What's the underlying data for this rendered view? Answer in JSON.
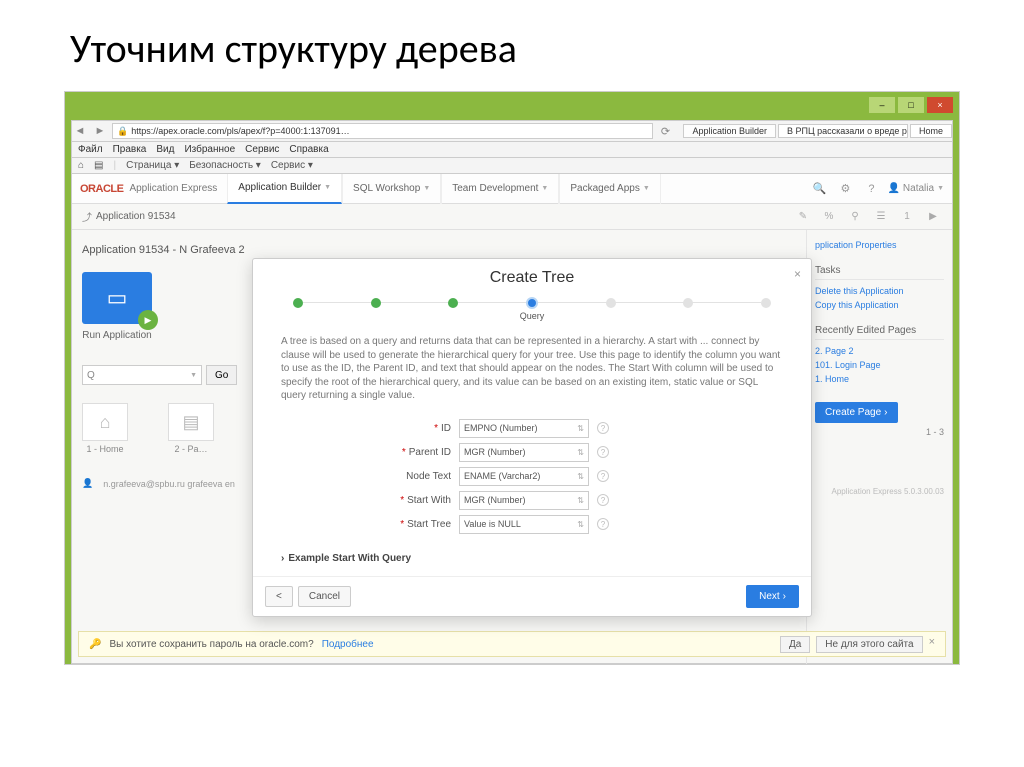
{
  "slide_title": "Уточним структуру дерева",
  "window_controls": {
    "min": "–",
    "max": "□",
    "close": "×"
  },
  "browser": {
    "url": "https://apex.oracle.com/pls/apex/f?p=4000:1:137091…",
    "tabs": [
      "Application Builder",
      "В РПЦ рассказали о вреде ра…",
      "Home"
    ]
  },
  "menu": [
    "Файл",
    "Правка",
    "Вид",
    "Избранное",
    "Сервис",
    "Справка"
  ],
  "toolbar": [
    "Страница ▾",
    "Безопасность ▾",
    "Сервис ▾"
  ],
  "apex": {
    "logo": "ORACLE",
    "product": "Application Express",
    "tabs": [
      "Application Builder",
      "SQL Workshop",
      "Team Development",
      "Packaged Apps"
    ],
    "user": "Natalia"
  },
  "breadcrumb": "Application 91534",
  "app_header": "Application 91534 - N Grafeeva 2",
  "tiles": {
    "run": "Run Application",
    "report": "report"
  },
  "search": {
    "placeholder": "Q",
    "go": "Go"
  },
  "page_tiles": [
    "1 - Home",
    "2 - Pa…"
  ],
  "footer_user": "n.grafeeva@spbu.ru    grafeeva    en",
  "right": {
    "props": "pplication Properties",
    "tasks_head": "Tasks",
    "tasks": [
      "Delete this Application",
      "Copy this Application"
    ],
    "recent_head": "Recently Edited Pages",
    "recent": [
      "2. Page 2",
      "101. Login Page",
      "1. Home"
    ],
    "create": "Create Page",
    "count": "1 - 3",
    "version": "Application Express 5.0.3.00.03"
  },
  "modal": {
    "title": "Create Tree",
    "step_label": "Query",
    "desc": "A tree is based on a query and returns data that can be represented in a hierarchy. A start with ... connect by clause will be used to generate the hierarchical query for your tree. Use this page to identify the column you want to use as the ID, the Parent ID, and text that should appear on the nodes. The Start With column will be used to specify the root of the hierarchical query, and its value can be based on an existing item, static value or SQL query returning a single value.",
    "fields": {
      "id": {
        "label": "ID",
        "value": "EMPNO (Number)"
      },
      "parent": {
        "label": "Parent ID",
        "value": "MGR (Number)"
      },
      "text": {
        "label": "Node Text",
        "value": "ENAME (Varchar2)"
      },
      "start": {
        "label": "Start With",
        "value": "MGR (Number)"
      },
      "tree": {
        "label": "Start Tree",
        "value": "Value is NULL"
      }
    },
    "expand": "Example Start With Query",
    "back": "<",
    "cancel": "Cancel",
    "next": "Next"
  },
  "savebar": {
    "text": "Вы хотите сохранить пароль на oracle.com?",
    "more": "Подробнее",
    "yes": "Да",
    "no": "Не для этого сайта"
  }
}
